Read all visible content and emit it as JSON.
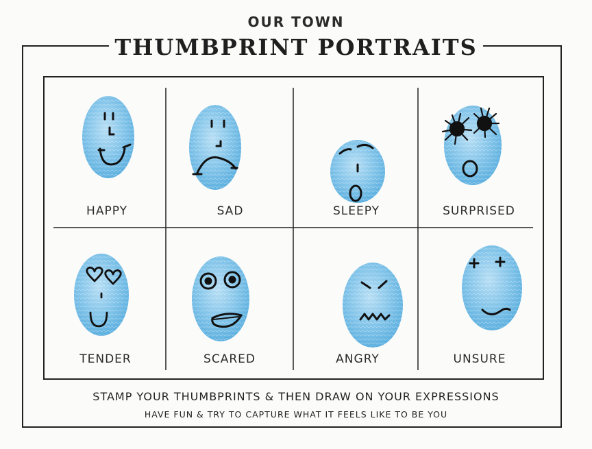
{
  "header": {
    "kicker": "OUR TOWN",
    "title": "THUMBPRINT PORTRAITS"
  },
  "expressions": [
    {
      "label": "HAPPY"
    },
    {
      "label": "SAD"
    },
    {
      "label": "SLEEPY"
    },
    {
      "label": "SURPRISED"
    },
    {
      "label": "TENDER"
    },
    {
      "label": "SCARED"
    },
    {
      "label": "ANGRY"
    },
    {
      "label": "UNSURE"
    }
  ],
  "footer": {
    "instruction": "STAMP YOUR THUMBPRINTS & THEN DRAW ON YOUR EXPRESSIONS",
    "tagline": "HAVE FUN & TRY TO CAPTURE  WHAT IT FEELS LIKE TO BE YOU"
  },
  "colors": {
    "ink": "#1f1f1f",
    "thumbprint": "#7fc2ea",
    "paper": "#fbfbf9"
  }
}
